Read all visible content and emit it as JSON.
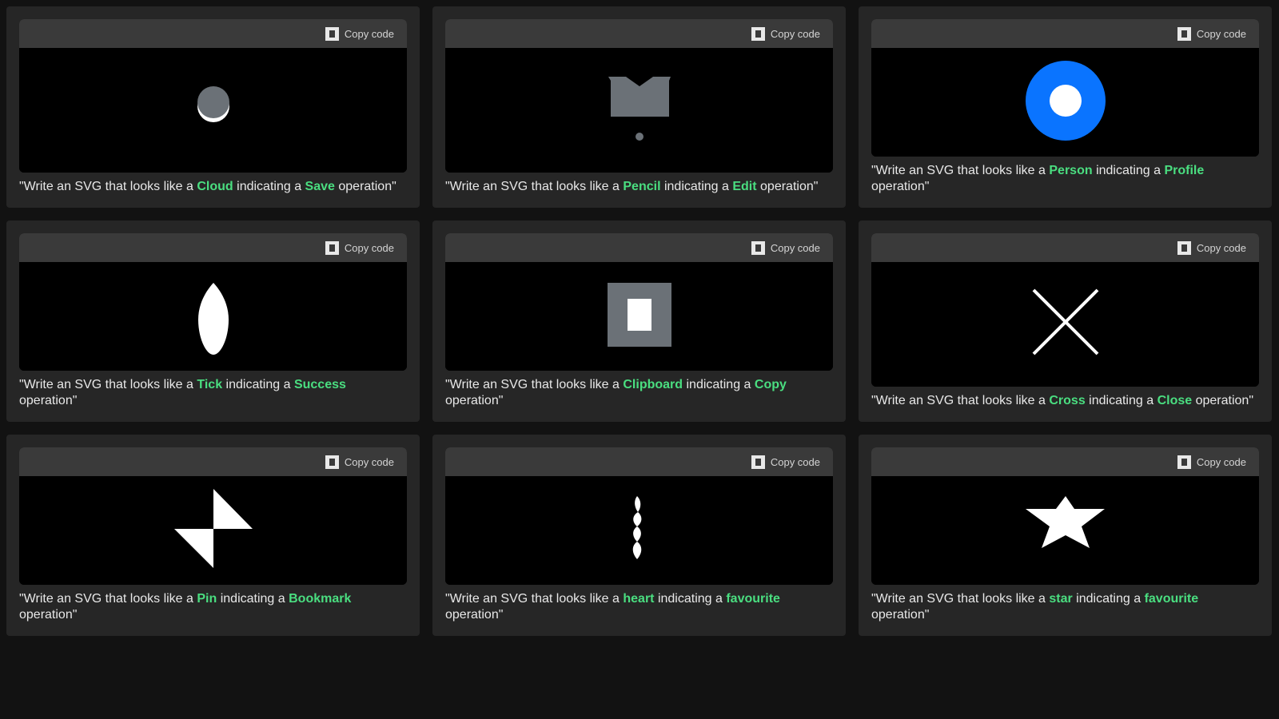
{
  "copy_label": "Copy code",
  "caption_prefix": "\"Write an SVG that looks like a ",
  "caption_middle": " indicating a ",
  "caption_suffix": " operation\"",
  "highlight_color": "#4ade80",
  "cards": [
    {
      "subject": "Cloud",
      "action": "Save",
      "icon": "cloud-icon"
    },
    {
      "subject": "Pencil",
      "action": "Edit",
      "icon": "pencil-icon"
    },
    {
      "subject": "Person",
      "action": "Profile",
      "icon": "person-icon"
    },
    {
      "subject": "Tick",
      "action": "Success",
      "icon": "tick-icon"
    },
    {
      "subject": "Clipboard",
      "action": "Copy",
      "icon": "clipboard-icon"
    },
    {
      "subject": "Cross",
      "action": "Close",
      "icon": "cross-icon"
    },
    {
      "subject": "Pin",
      "action": "Bookmark",
      "icon": "pin-icon"
    },
    {
      "subject": "heart",
      "action": "favourite",
      "icon": "heart-icon"
    },
    {
      "subject": "star",
      "action": "favourite",
      "icon": "star-icon"
    }
  ]
}
